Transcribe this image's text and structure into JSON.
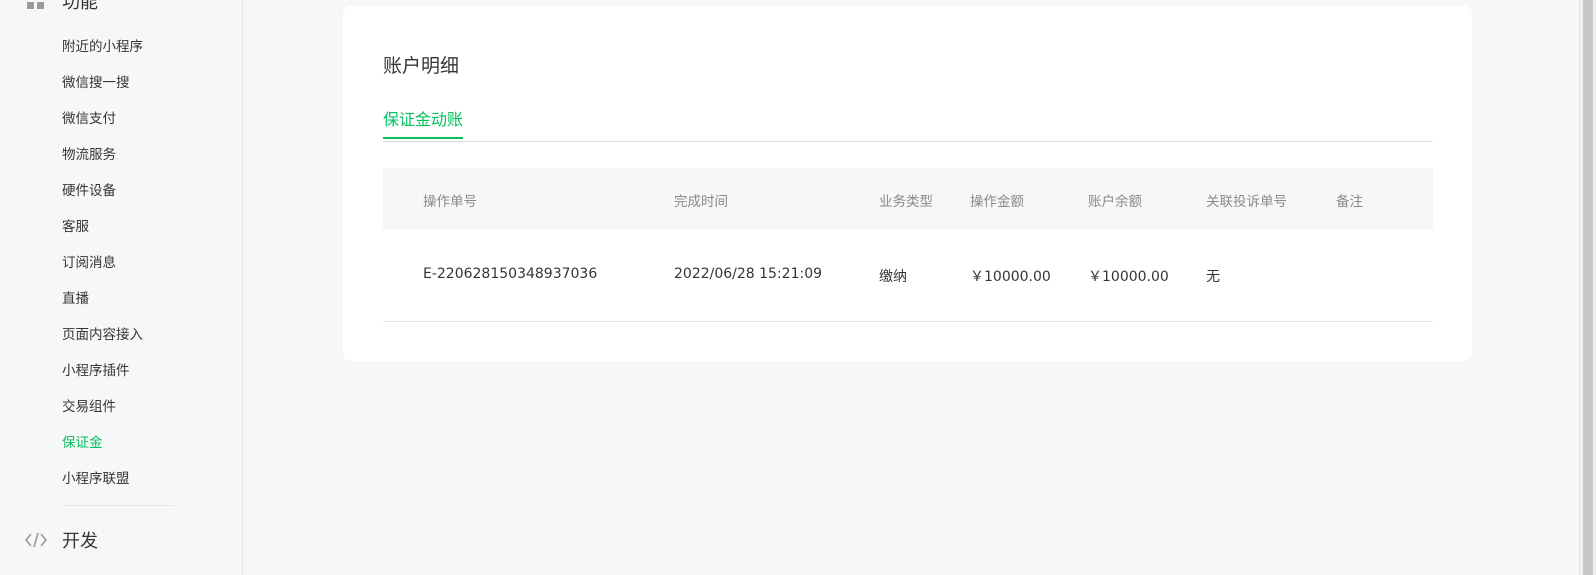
{
  "sidebar": {
    "section_top": {
      "label": "功能",
      "icon": "grid-icon"
    },
    "items": [
      {
        "label": "附近的小程序",
        "active": false
      },
      {
        "label": "微信搜一搜",
        "active": false
      },
      {
        "label": "微信支付",
        "active": false
      },
      {
        "label": "物流服务",
        "active": false
      },
      {
        "label": "硬件设备",
        "active": false
      },
      {
        "label": "客服",
        "active": false
      },
      {
        "label": "订阅消息",
        "active": false
      },
      {
        "label": "直播",
        "active": false
      },
      {
        "label": "页面内容接入",
        "active": false
      },
      {
        "label": "小程序插件",
        "active": false
      },
      {
        "label": "交易组件",
        "active": false
      },
      {
        "label": "保证金",
        "active": true
      },
      {
        "label": "小程序联盟",
        "active": false
      }
    ],
    "section_dev": {
      "label": "开发",
      "icon": "code-icon"
    }
  },
  "main": {
    "title": "账户明细",
    "tabs": [
      {
        "label": "保证金动账",
        "active": true
      }
    ],
    "table": {
      "columns": [
        "操作单号",
        "完成时间",
        "业务类型",
        "操作金额",
        "账户余额",
        "关联投诉单号",
        "备注"
      ],
      "rows": [
        [
          "E-220628150348937036",
          "2022/06/28 15:21:09",
          "缴纳",
          "￥10000.00",
          "￥10000.00",
          "无",
          ""
        ]
      ]
    }
  },
  "colors": {
    "accent": "#07c160",
    "background": "#f6f7f9",
    "card": "#ffffff"
  }
}
